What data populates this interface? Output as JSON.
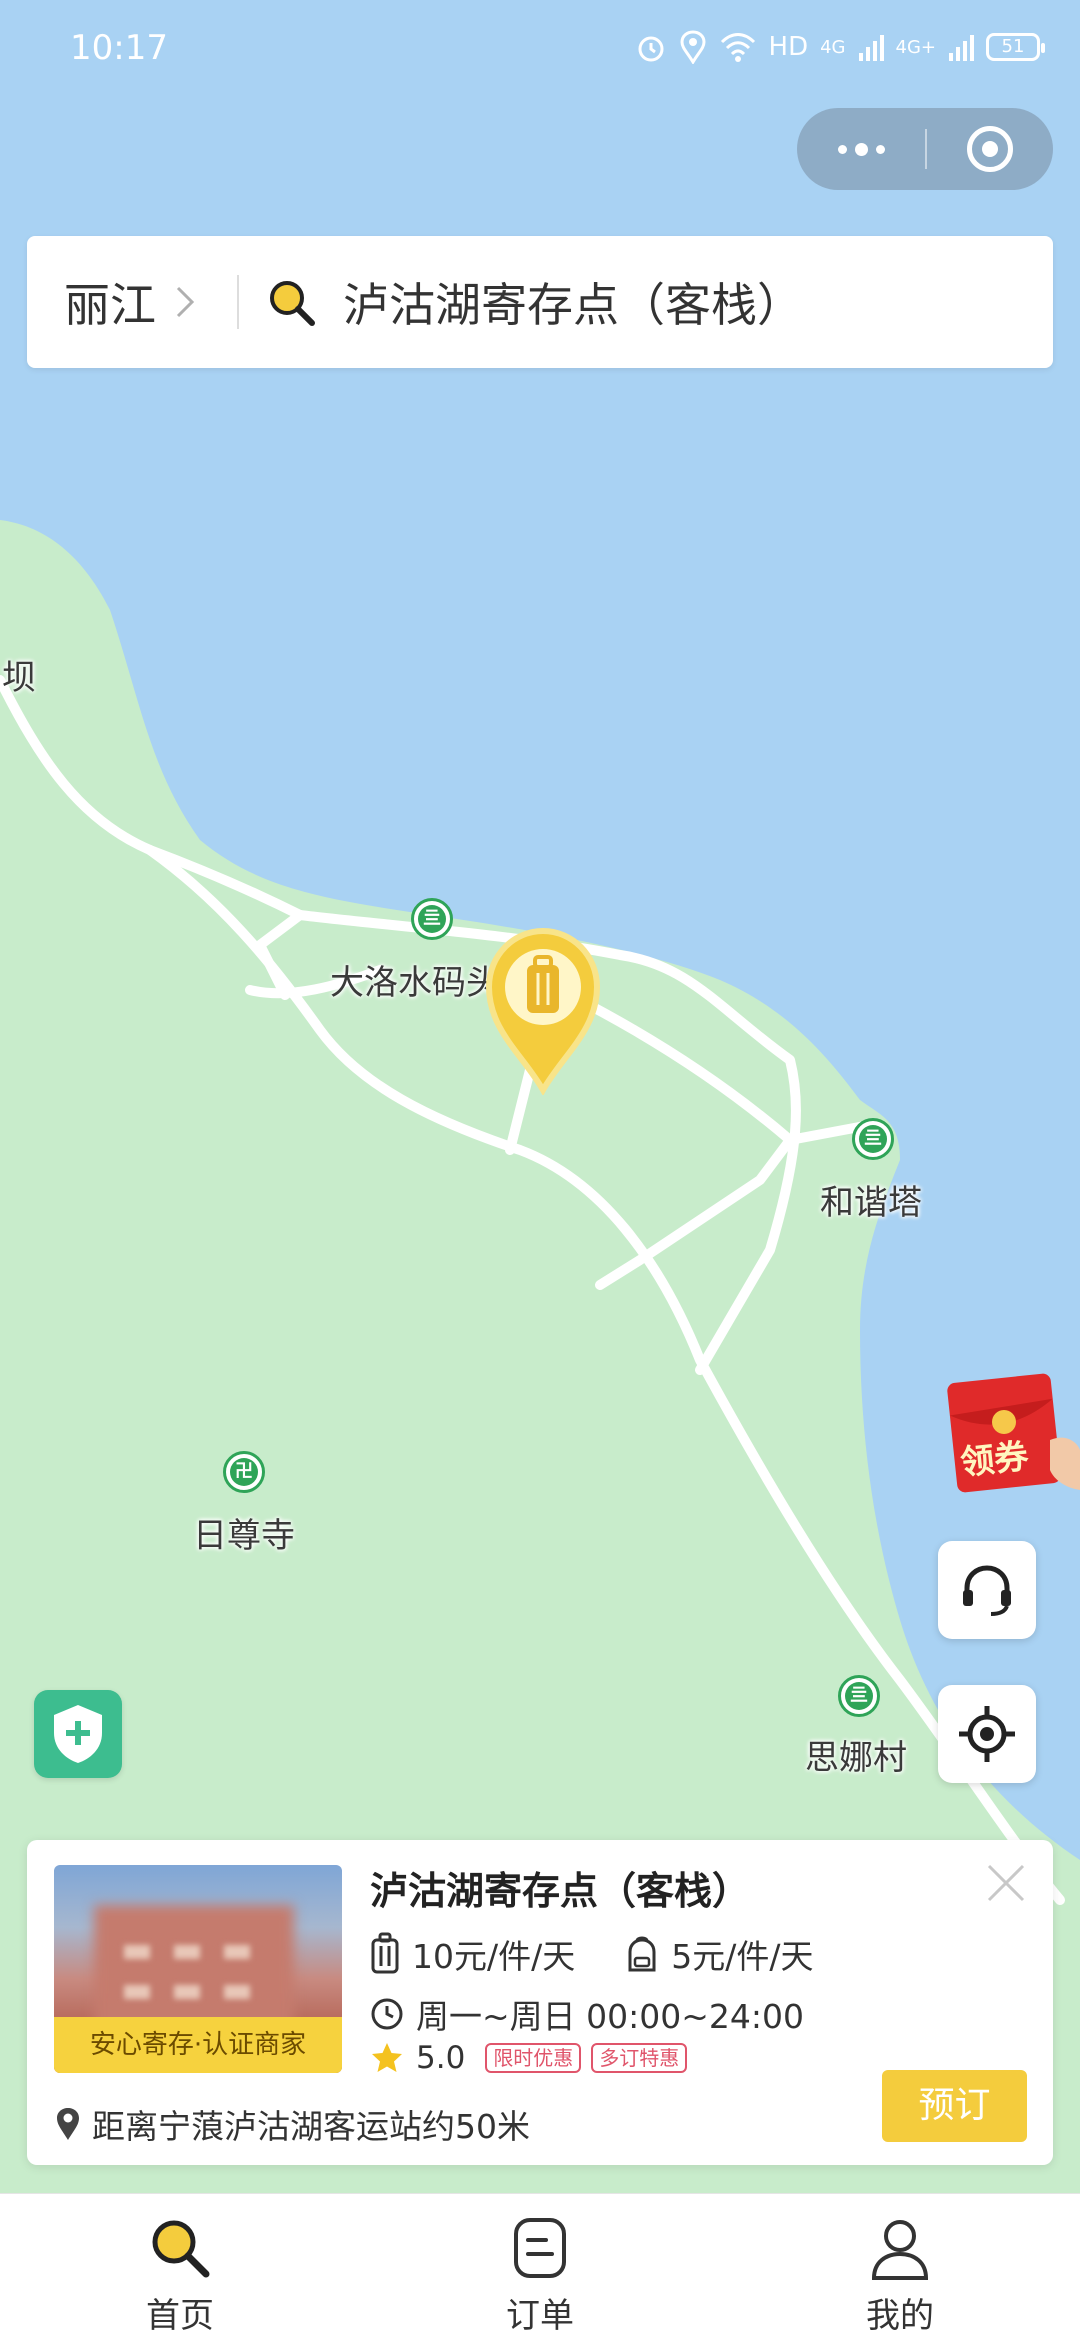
{
  "status_bar": {
    "time": "10:17",
    "network_label": "HD",
    "signal_1": "4G",
    "signal_2": "4G+",
    "battery": "51"
  },
  "search": {
    "city": "丽江",
    "query": "泸沽湖寄存点（客栈）"
  },
  "map": {
    "labels": {
      "pier": "大洛水码头",
      "pagoda": "和谐塔",
      "temple": "日尊寺",
      "village": "思娜村",
      "edge": "坝"
    }
  },
  "coupon": {
    "label": "领券"
  },
  "store": {
    "name": "泸沽湖寄存点（客栈）",
    "badge": "安心寄存·认证商家",
    "price_luggage": "10元/件/天",
    "price_bag": "5元/件/天",
    "hours": "周一~周日 00:00~24:00",
    "rating": "5.0",
    "tags": [
      "限时优惠",
      "多订特惠"
    ],
    "distance": "距离宁蒗泸沽湖客运站约50米",
    "reserve_label": "预订"
  },
  "tabs": [
    {
      "label": "首页",
      "icon": "search-icon"
    },
    {
      "label": "订单",
      "icon": "order-icon"
    },
    {
      "label": "我的",
      "icon": "user-icon"
    }
  ],
  "colors": {
    "water": "#a9d2f3",
    "land": "#c8eccb",
    "accent": "#f4cc3d",
    "poi_green": "#2fa458"
  }
}
